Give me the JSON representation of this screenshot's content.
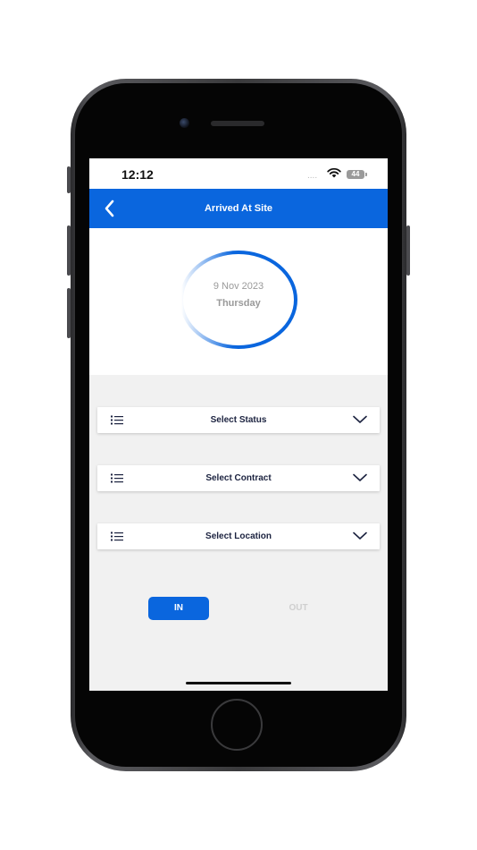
{
  "status_bar": {
    "time": "12:12",
    "signal": "....",
    "battery": "44"
  },
  "header": {
    "title": "Arrived At Site",
    "back_icon": "chevron-left-icon"
  },
  "date_card": {
    "date": "9 Nov 2023",
    "weekday": "Thursday"
  },
  "selects": [
    {
      "label": "Select Status",
      "icon": "list-icon"
    },
    {
      "label": "Select Contract",
      "icon": "list-icon"
    },
    {
      "label": "Select Location",
      "icon": "list-icon"
    }
  ],
  "toggle": {
    "in_label": "IN",
    "out_label": "OUT",
    "selected": "IN"
  },
  "colors": {
    "accent": "#0a66de",
    "background": "#f1f1f1",
    "label_dark": "#1c2340"
  }
}
